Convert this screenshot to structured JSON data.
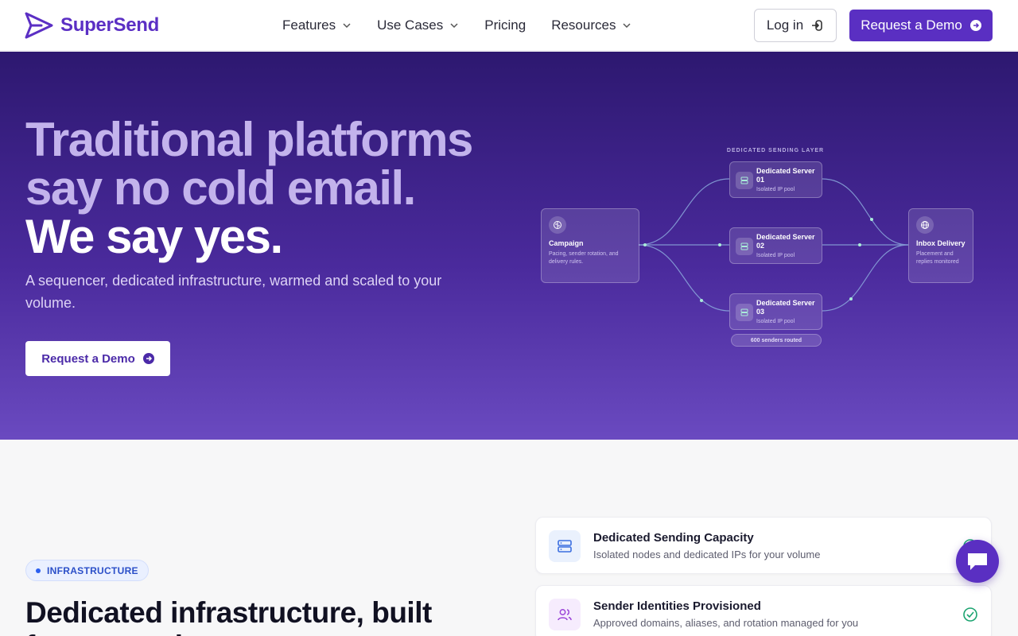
{
  "brand": {
    "name": "SuperSend",
    "color": "#5b2fc4"
  },
  "nav": {
    "items": [
      {
        "label": "Features",
        "dropdown": true
      },
      {
        "label": "Use Cases",
        "dropdown": true
      },
      {
        "label": "Pricing",
        "dropdown": false
      },
      {
        "label": "Resources",
        "dropdown": true
      }
    ],
    "login_label": "Log in",
    "demo_label": "Request a Demo"
  },
  "hero": {
    "headline_line1": "Traditional platforms",
    "headline_line2": "say no cold email.",
    "headline_line3": "We say yes.",
    "subtitle": "A sequencer, dedicated infrastructure, warmed and scaled to your volume.",
    "cta_label": "Request a Demo"
  },
  "diagram": {
    "layer_label": "DEDICATED SENDING LAYER",
    "campaign": {
      "title": "Campaign",
      "desc": "Pacing, sender rotation, and delivery rules.",
      "icon": "brain-icon"
    },
    "servers": [
      {
        "title": "Dedicated Server 01",
        "desc": "Isolated IP pool",
        "icon": "server-icon"
      },
      {
        "title": "Dedicated Server 02",
        "desc": "Isolated IP pool",
        "icon": "server-icon"
      },
      {
        "title": "Dedicated Server 03",
        "desc": "Isolated IP pool",
        "icon": "server-icon"
      }
    ],
    "inbox": {
      "title": "Inbox Delivery",
      "desc": "Placement and replies monitored",
      "icon": "globe-icon"
    },
    "senders_pill": "600 senders routed"
  },
  "section": {
    "badge": "INFRASTRUCTURE",
    "title_line1": "Dedicated infrastructure, built",
    "title_line2": "for your volume",
    "cards": [
      {
        "title": "Dedicated Sending Capacity",
        "desc": "Isolated nodes and dedicated IPs for your volume",
        "icon": "server-icon",
        "accent": "#3b6fe0"
      },
      {
        "title": "Sender Identities Provisioned",
        "desc": "Approved domains, aliases, and rotation managed for you",
        "icon": "users-icon",
        "accent": "#9b45d8"
      }
    ]
  },
  "colors": {
    "primary": "#5a2fc2",
    "check": "#1aa36f"
  }
}
